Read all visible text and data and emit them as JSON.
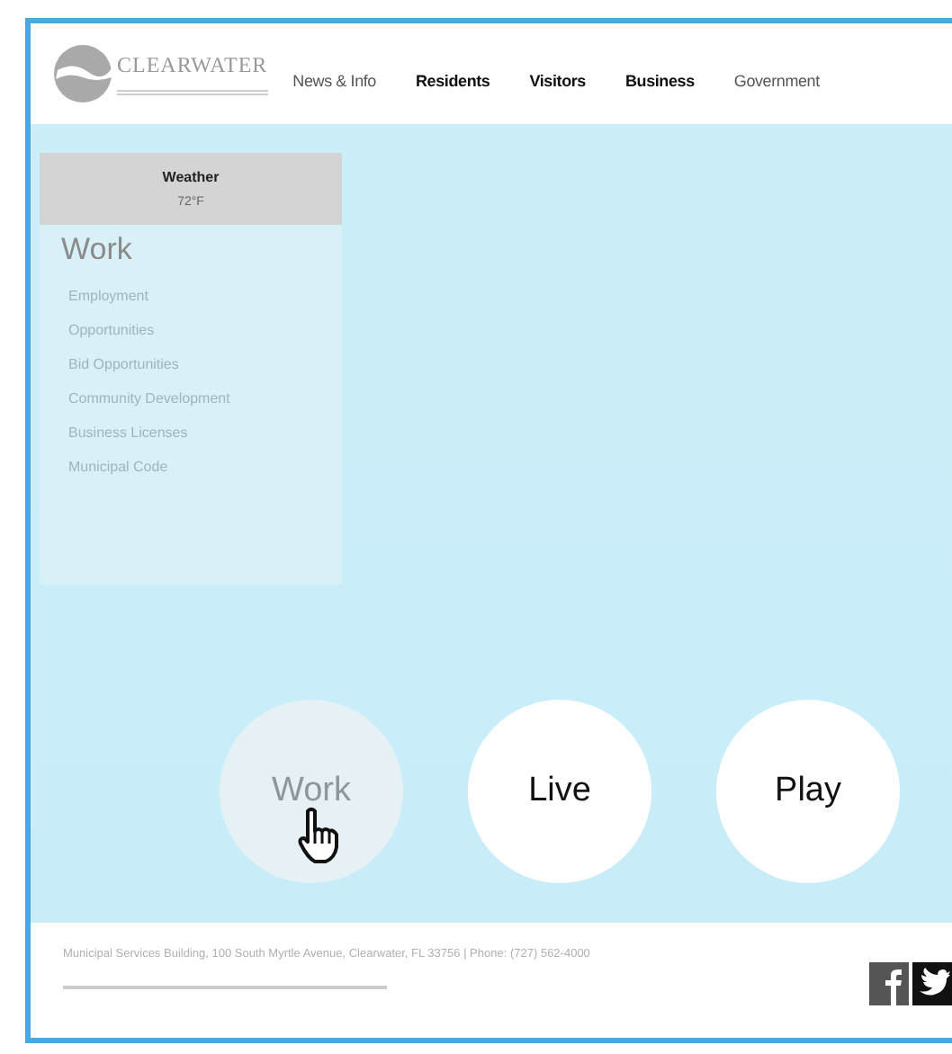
{
  "header": {
    "logo_text": "CLEARWATER",
    "nav": [
      "News & Info",
      "Residents",
      "Visitors",
      "Business",
      "Government"
    ]
  },
  "sidebar": {
    "weather": {
      "label": "Weather",
      "reading": "72°F"
    },
    "heading": "Work",
    "items": [
      "Employment",
      "Opportunities",
      "Bid Opportunities",
      "Community Development",
      "Business Licenses",
      "Municipal Code"
    ]
  },
  "circles": [
    {
      "label": "Work",
      "hovered": true
    },
    {
      "label": "Live",
      "hovered": false
    },
    {
      "label": "Play",
      "hovered": false
    }
  ],
  "footer": {
    "address": "Municipal Services Building, 100 South Myrtle Avenue, Clearwater, FL 33756  |  Phone: (727) 562-4000"
  }
}
